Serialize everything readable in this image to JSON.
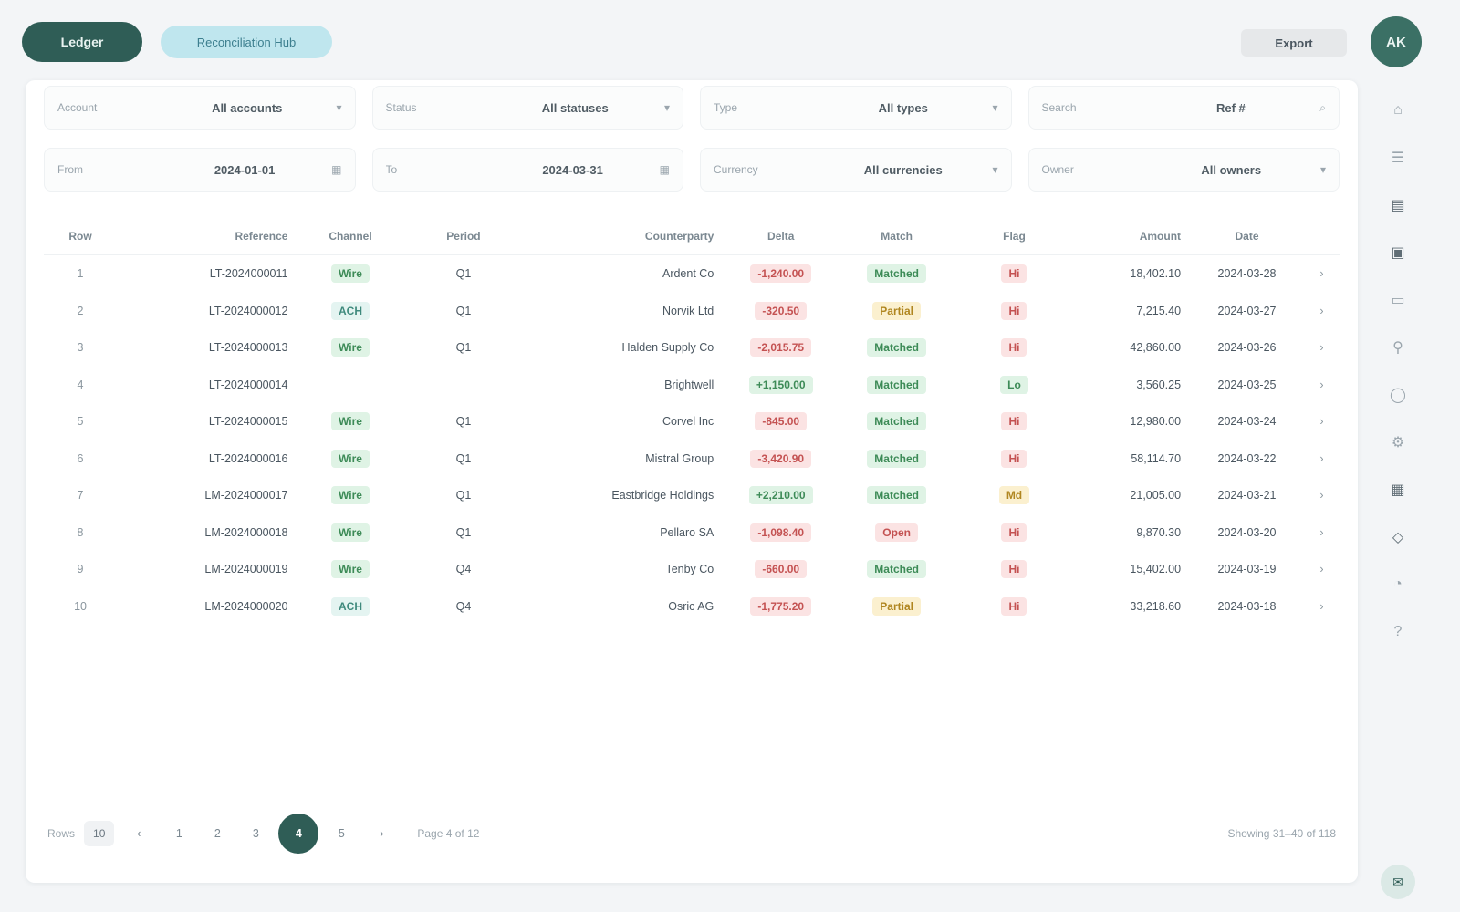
{
  "header": {
    "brand": "Ledger",
    "context": "Reconciliation Hub",
    "action": "Export",
    "avatar": "AK"
  },
  "filters_row1": [
    {
      "label": "Account",
      "value": "All accounts",
      "icon": "chevron-down-icon"
    },
    {
      "label": "Status",
      "value": "All statuses",
      "icon": "chevron-down-icon"
    },
    {
      "label": "Type",
      "value": "All types",
      "icon": "chevron-down-icon"
    },
    {
      "label": "Search",
      "value": "Ref #",
      "icon": "search-icon"
    }
  ],
  "filters_row2": [
    {
      "label": "From",
      "value": "2024-01-01",
      "icon": "calendar-icon"
    },
    {
      "label": "To",
      "value": "2024-03-31",
      "icon": "calendar-icon"
    },
    {
      "label": "Currency",
      "value": "All currencies",
      "icon": "chevron-down-icon"
    },
    {
      "label": "Owner",
      "value": "All owners",
      "icon": "chevron-down-icon"
    }
  ],
  "table": {
    "columns": [
      "Row",
      "Reference",
      "Channel",
      "Period",
      "Counterparty",
      "Delta",
      "Match",
      "Flag",
      "Amount",
      "Date",
      ""
    ],
    "rows": [
      {
        "n": "1",
        "ref": "LT-2024000011",
        "chan": "Wire",
        "per": "Q1",
        "cp": "Ardent Co",
        "delta": "-1,240.00",
        "match": "Matched",
        "flag": "Hi",
        "amt": "18,402.10",
        "date": "2024-03-28",
        "ck": "›"
      },
      {
        "n": "2",
        "ref": "LT-2024000012",
        "chan": "ACH",
        "per": "Q1",
        "cp": "Norvik Ltd",
        "delta": "-320.50",
        "match": "Partial",
        "flag": "Hi",
        "amt": "7,215.40",
        "date": "2024-03-27",
        "ck": "›"
      },
      {
        "n": "3",
        "ref": "LT-2024000013",
        "chan": "Wire",
        "per": "Q1",
        "cp": "Halden Supply Co",
        "delta": "-2,015.75",
        "match": "Matched",
        "flag": "Hi",
        "amt": "42,860.00",
        "date": "2024-03-26",
        "ck": "›"
      },
      {
        "n": "4",
        "ref": "LT-2024000014",
        "chan": "",
        "per": "",
        "cp": "Brightwell",
        "delta": "+1,150.00",
        "match": "Matched",
        "flag": "Lo",
        "amt": "3,560.25",
        "date": "2024-03-25",
        "ck": "›"
      },
      {
        "n": "5",
        "ref": "LT-2024000015",
        "chan": "Wire",
        "per": "Q1",
        "cp": "Corvel Inc",
        "delta": "-845.00",
        "match": "Matched",
        "flag": "Hi",
        "amt": "12,980.00",
        "date": "2024-03-24",
        "ck": "›"
      },
      {
        "n": "6",
        "ref": "LT-2024000016",
        "chan": "Wire",
        "per": "Q1",
        "cp": "Mistral Group",
        "delta": "-3,420.90",
        "match": "Matched",
        "flag": "Hi",
        "amt": "58,114.70",
        "date": "2024-03-22",
        "ck": "›"
      },
      {
        "n": "7",
        "ref": "LM-2024000017",
        "chan": "Wire",
        "per": "Q1",
        "cp": "Eastbridge Holdings",
        "delta": "+2,210.00",
        "match": "Matched",
        "flag": "Md",
        "amt": "21,005.00",
        "date": "2024-03-21",
        "ck": "›"
      },
      {
        "n": "8",
        "ref": "LM-2024000018",
        "chan": "Wire",
        "per": "Q1",
        "cp": "Pellaro SA",
        "delta": "-1,098.40",
        "match": "Open",
        "flag": "Hi",
        "amt": "9,870.30",
        "date": "2024-03-20",
        "ck": "›"
      },
      {
        "n": "9",
        "ref": "LM-2024000019",
        "chan": "Wire",
        "per": "Q4",
        "cp": "Tenby Co",
        "delta": "-660.00",
        "match": "Matched",
        "flag": "Hi",
        "amt": "15,402.00",
        "date": "2024-03-19",
        "ck": "›"
      },
      {
        "n": "10",
        "ref": "LM-2024000020",
        "chan": "ACH",
        "per": "Q4",
        "cp": "Osric AG",
        "delta": "-1,775.20",
        "match": "Partial",
        "flag": "Hi",
        "amt": "33,218.60",
        "date": "2024-03-18",
        "ck": "›"
      }
    ]
  },
  "pager": {
    "rows_label": "Rows",
    "page_size": "10",
    "prev": "‹",
    "pages": [
      "1",
      "2",
      "3",
      "4",
      "5"
    ],
    "active": "4",
    "next": "›",
    "info": "Page 4 of 12",
    "total": "Showing 31–40 of 118"
  },
  "rail": [
    "home-icon",
    "list-icon",
    "chart-icon",
    "wallet-icon",
    "doc-icon",
    "filter-icon",
    "user-icon",
    "settings-icon",
    "calendar-icon",
    "tag-icon",
    "bell-icon",
    "help-icon"
  ],
  "colors": {
    "brand": "#2f5d56",
    "accent": "#bfe6ee",
    "green": "#3d8b57",
    "red": "#c45252",
    "amber": "#b08620"
  }
}
